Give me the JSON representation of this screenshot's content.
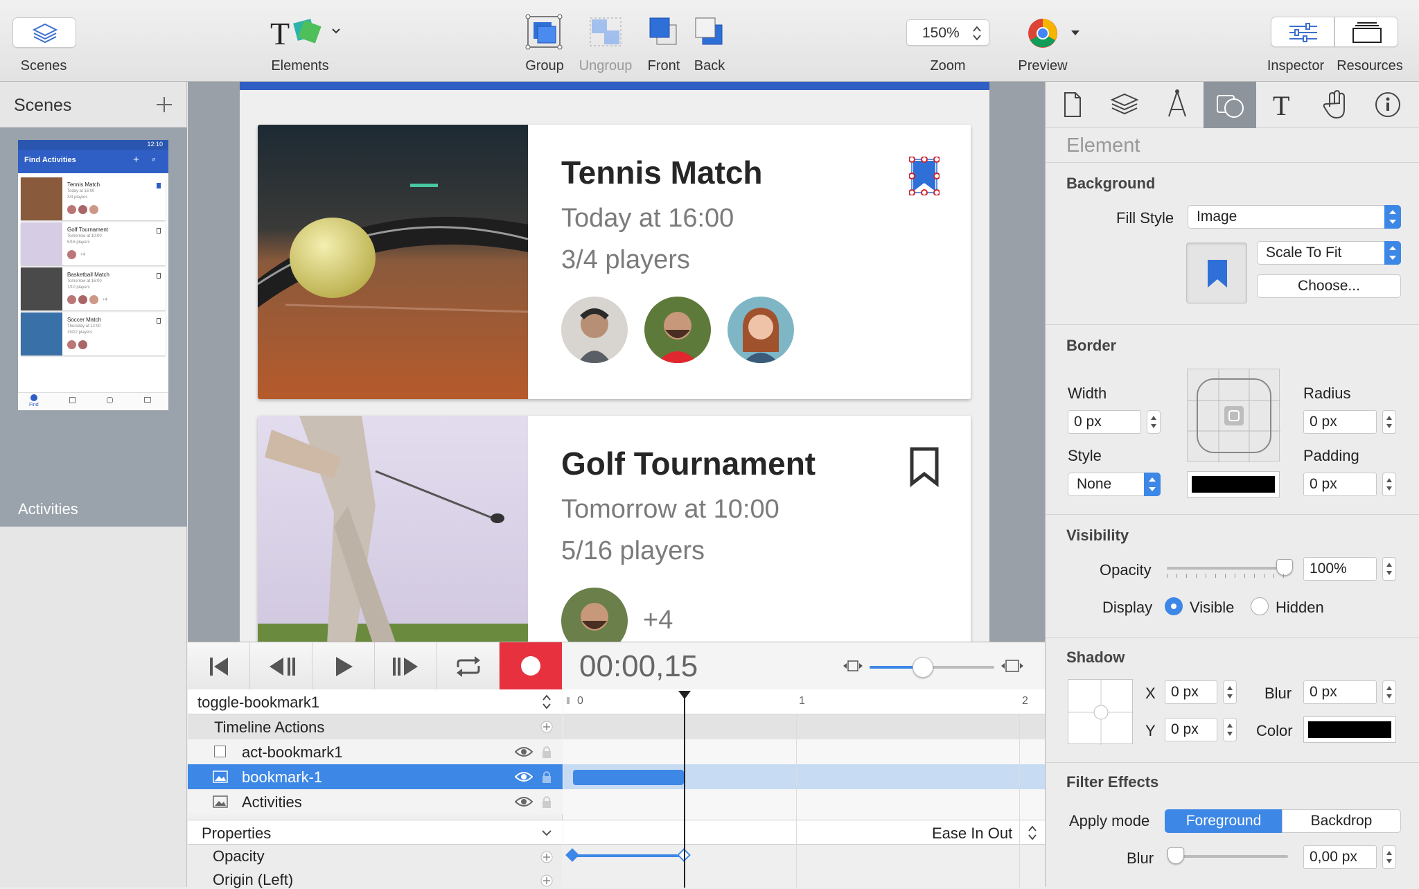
{
  "toolbar": {
    "scenes_label": "Scenes",
    "elements_label": "Elements",
    "group_label": "Group",
    "ungroup_label": "Ungroup",
    "front_label": "Front",
    "back_label": "Back",
    "zoom_label": "Zoom",
    "zoom_value": "150%",
    "preview_label": "Preview",
    "inspector_label": "Inspector",
    "resources_label": "Resources"
  },
  "scenes_panel": {
    "title": "Scenes",
    "scene_name": "Activities",
    "thumb": {
      "status_time": "12:10",
      "app_title": "Find Activities",
      "items": [
        {
          "title": "Tennis Match",
          "line1": "Today at 16:00",
          "line2": "3/4 players"
        },
        {
          "title": "Golf Tournament",
          "line1": "Tomorrow at 10:00",
          "line2": "5/16 players",
          "extra": "+4"
        },
        {
          "title": "Basketball Match",
          "line1": "Tomorrow at 16:00",
          "line2": "7/10 players",
          "extra": "+4"
        },
        {
          "title": "Soccer Match",
          "line1": "Thursday at 12:00",
          "line2": "15/22 players"
        }
      ],
      "nav_find": "Find"
    }
  },
  "canvas": {
    "cards": [
      {
        "title": "Tennis Match",
        "time": "Today at 16:00",
        "players": "3/4 players"
      },
      {
        "title": "Golf Tournament",
        "time": "Tomorrow at 10:00",
        "players": "5/16 players",
        "extra": "+4"
      }
    ]
  },
  "timeline": {
    "time": "00:00,15",
    "timeline_name": "toggle-bookmark1",
    "timeline_actions": "Timeline Actions",
    "layers": [
      {
        "name": "act-bookmark1"
      },
      {
        "name": "bookmark-1"
      },
      {
        "name": "Activities"
      }
    ],
    "properties_label": "Properties",
    "easing": "Ease In Out",
    "props": [
      "Opacity",
      "Origin (Left)"
    ],
    "ruler": [
      "0",
      "1",
      "2"
    ]
  },
  "inspector": {
    "section_title": "Element",
    "background": {
      "title": "Background",
      "fill_style_label": "Fill Style",
      "fill_style_value": "Image",
      "scale_value": "Scale To Fit",
      "choose_label": "Choose..."
    },
    "border": {
      "title": "Border",
      "width_label": "Width",
      "width_value": "0 px",
      "radius_label": "Radius",
      "radius_value": "0 px",
      "style_label": "Style",
      "style_value": "None",
      "padding_label": "Padding",
      "padding_value": "0 px"
    },
    "visibility": {
      "title": "Visibility",
      "opacity_label": "Opacity",
      "opacity_value": "100%",
      "opacity_level": 1.0,
      "display_label": "Display",
      "visible_label": "Visible",
      "hidden_label": "Hidden"
    },
    "shadow": {
      "title": "Shadow",
      "x_label": "X",
      "x_value": "0 px",
      "y_label": "Y",
      "y_value": "0 px",
      "blur_label": "Blur",
      "blur_value": "0 px",
      "color_label": "Color"
    },
    "filter": {
      "title": "Filter Effects",
      "apply_mode_label": "Apply mode",
      "foreground_label": "Foreground",
      "backdrop_label": "Backdrop",
      "blur_label": "Blur",
      "blur_value": "0,00 px"
    }
  },
  "colors": {
    "accent": "#3d87e6",
    "record": "#e8313f",
    "selection": "#2f6fd8",
    "app_bar": "#2f5fc4"
  }
}
